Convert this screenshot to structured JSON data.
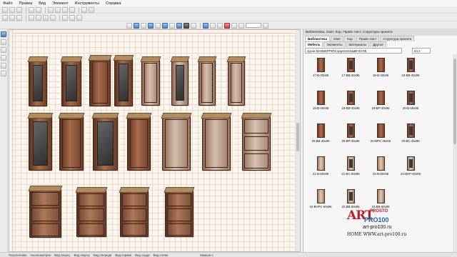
{
  "menu": {
    "items": [
      "Файл",
      "Правка",
      "Вид",
      "Элемент",
      "Инструменты",
      "Справка"
    ]
  },
  "toolbar": {
    "zoom_value": ""
  },
  "library": {
    "title": "Библиотека, Свет, Кор, Прайс-лист, Структура проекта",
    "top_tabs": [
      "Библиотека",
      "Свет",
      "Кор",
      "Прайс-лист",
      "Структура проекта"
    ],
    "sub_tabs": [
      "Мебель",
      "Элементы",
      "Материалы",
      "Другое"
    ],
    "path": "кухни МАКБЕРРИ\\Copperents\\ШВ-03-96",
    "zoom": "64 x",
    "items": [
      {
        "label": "17-B-33x96",
        "style": "dark"
      },
      {
        "label": "17-BB-33x96",
        "style": "dark"
      },
      {
        "label": "18-B-33x96",
        "style": "dark"
      },
      {
        "label": "18-BB-33x96",
        "style": "dark"
      },
      {
        "label": "19-B-40x96",
        "style": "dark"
      },
      {
        "label": "19-BB-40x96",
        "style": "dark"
      },
      {
        "label": "19-BP-40x96",
        "style": "dark"
      },
      {
        "label": "20-B-45x96",
        "style": "dark"
      },
      {
        "label": "20-BB-45x96",
        "style": "dark"
      },
      {
        "label": "20-BP-45x96",
        "style": "dark"
      },
      {
        "label": "20-BPC-45x96",
        "style": "dark"
      },
      {
        "label": "20-BC-45x96",
        "style": "dark"
      },
      {
        "label": "21-B-60x96",
        "style": "light"
      },
      {
        "label": "21-BC-60x96",
        "style": "light"
      },
      {
        "label": "22-B-60x96",
        "style": "light"
      },
      {
        "label": "22-BHF-60x96",
        "style": "light"
      },
      {
        "label": "22-BHFC-60x96",
        "style": "light"
      },
      {
        "label": "22-BB-60x96",
        "style": "light"
      },
      {
        "label": "22-BB-60x96",
        "style": "light"
      }
    ]
  },
  "status_tabs": [
    "Перспектива",
    "Аксонометрия",
    "Вид сверху",
    "Вид сверху",
    "Вид спереди",
    "Вид справа",
    "Вид сзади",
    "Вид слева",
    "Камера 1"
  ],
  "watermark": {
    "art": "ART",
    "prosto": "PROSTO",
    "pro100": "PRO100",
    "url": "art-pro100.ru",
    "home": "HOME WWW.art-pro100.ru"
  },
  "colors": {
    "accent": "#4a82c4",
    "wood_dark": "#7a4428",
    "wood_light": "#d6bfae",
    "grid": "#f0d8c4",
    "brand_red": "#b8202a",
    "brand_blue": "#2a5aa8"
  }
}
